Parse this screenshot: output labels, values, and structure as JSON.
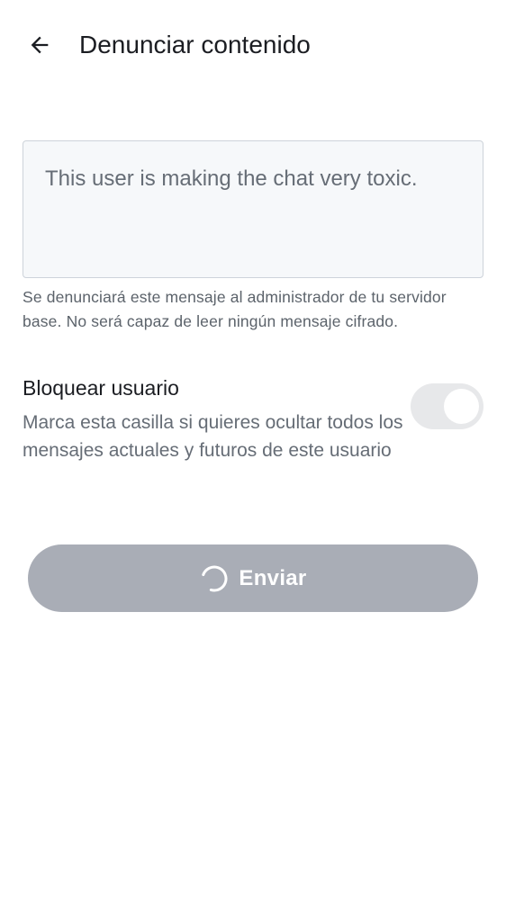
{
  "header": {
    "back_icon": "arrow-left-icon",
    "title": "Denunciar contenido"
  },
  "report": {
    "reason_value": "This user is making the chat very toxic.",
    "hint": "Se denunciará este mensaje al administrador de tu servidor base. No será capaz de leer ningún mensaje cifrado."
  },
  "block_user": {
    "label": "Bloquear usuario",
    "description": "Marca esta casilla si quieres ocultar todos los mensajes actuales y futuros de este usuario",
    "toggle_on": true
  },
  "submit": {
    "label": "Enviar",
    "loading_icon": "spinner-icon",
    "state": "loading"
  },
  "colors": {
    "text_primary": "#1b1d22",
    "text_secondary": "#666d76",
    "field_bg": "#f6f8fa",
    "field_border": "#cdd3da",
    "button_disabled": "#a9adb6",
    "toggle_track": "#e7e8ea"
  }
}
